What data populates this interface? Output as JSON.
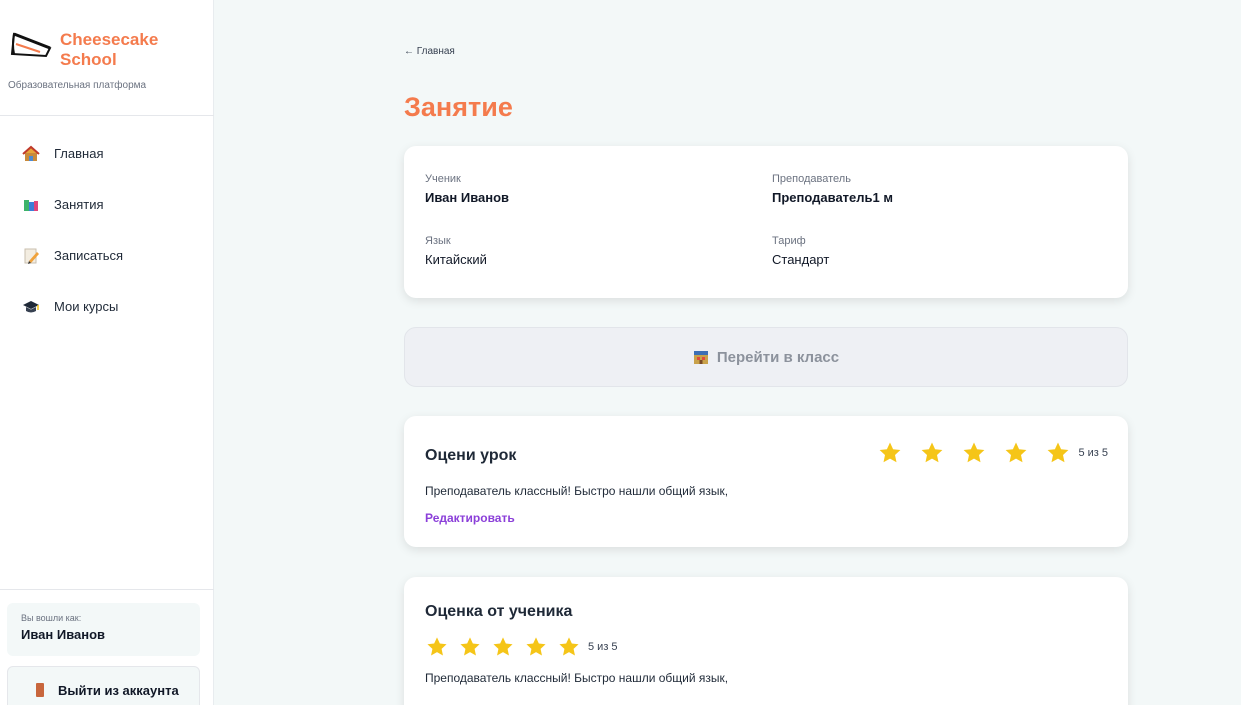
{
  "brand": {
    "name_line1": "Cheesecake",
    "name_line2": "School",
    "subtitle": "Образовательная платформа"
  },
  "sidebar": {
    "items": [
      {
        "label": "Главная",
        "icon": "house-icon"
      },
      {
        "label": "Занятия",
        "icon": "books-icon"
      },
      {
        "label": "Записаться",
        "icon": "memo-icon"
      },
      {
        "label": "Мои курсы",
        "icon": "graduation-cap-icon"
      }
    ],
    "user_label": "Вы вошли как:",
    "user_name": "Иван Иванов",
    "logout_label": "Выйти из аккаунта"
  },
  "main": {
    "back_link": "← Главная",
    "title": "Занятие",
    "info": {
      "student_label": "Ученик",
      "student_value": "Иван Иванов",
      "teacher_label": "Преподаватель",
      "teacher_value": "Преподаватель1 м",
      "language_label": "Язык",
      "language_value": "Китайский",
      "tariff_label": "Тариф",
      "tariff_value": "Стандарт"
    },
    "class_button": "Перейти в класс",
    "rate": {
      "title": "Оцени урок",
      "rating": 5,
      "rating_text": "5 из 5",
      "comment": "Преподаватель классный! Быстро нашли общий язык,",
      "edit_label": "Редактировать"
    },
    "student_rating": {
      "title": "Оценка от ученика",
      "rating": 5,
      "rating_text": "5 из 5",
      "comment": "Преподаватель классный! Быстро нашли общий язык,"
    }
  },
  "colors": {
    "accent": "#f47b4d",
    "star": "#f5c518",
    "link": "#8b3fd9",
    "background": "#f3f8f8"
  }
}
